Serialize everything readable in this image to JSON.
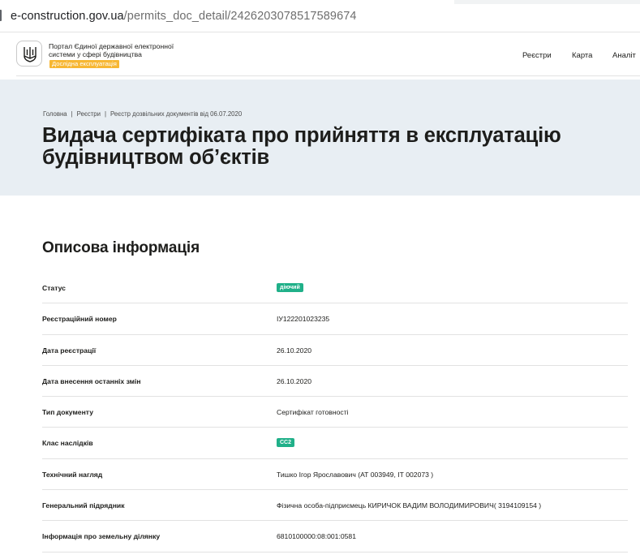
{
  "browser": {
    "url_domain": "e-construction.gov.ua",
    "url_path": "/permits_doc_detail/2426203078517589674"
  },
  "header": {
    "portal_text": "Портал Єдиної державної електронної системи у сфері будівництва",
    "beta_label": "Дослідна експлуатація",
    "nav": [
      "Реєстри",
      "Карта",
      "Аналіт"
    ],
    "logo_icon": "trident-icon"
  },
  "breadcrumb": [
    "Головна",
    "Реєстри",
    "Реєстр дозвільних документів від 06.07.2020"
  ],
  "page": {
    "title_line1": "Видача сертифіката про прийняття в експлуатацію",
    "title_line2": "будівництвом об’єктів"
  },
  "section": {
    "title": "Описова інформація",
    "rows": [
      {
        "label": "Статус",
        "value": "діючий",
        "badge": true
      },
      {
        "label": "Реєстраційний номер",
        "value": "ІУ122201023235"
      },
      {
        "label": "Дата реєстрації",
        "value": "26.10.2020"
      },
      {
        "label": "Дата внесення останніх змін",
        "value": "26.10.2020"
      },
      {
        "label": "Тип документу",
        "value": "Сертифікат готовності"
      },
      {
        "label": "Клас наслідків",
        "value": "СС2",
        "badge": true
      },
      {
        "label": "Технічний нагляд",
        "value": "Тишко Ігор Ярославович (АТ 003949, ІТ 002073 )"
      },
      {
        "label": "Генеральний підрядник",
        "value": "Фізична особа-підприємець КИРИЧОК ВАДИМ ВОЛОДИМИРОВИЧ( 3194109154 )"
      },
      {
        "label": "Інформація про земельну ділянку",
        "value": "6810100000:08:001:0581"
      }
    ]
  },
  "colors": {
    "hero_bg": "#e8eef3",
    "badge_green": "#20b089",
    "beta_orange": "#f7b733"
  }
}
